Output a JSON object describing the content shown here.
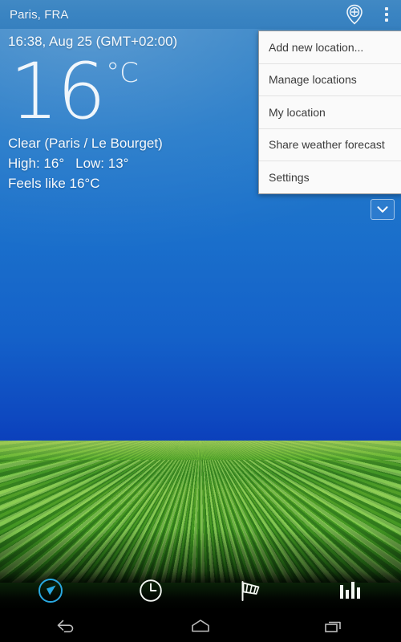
{
  "app": {
    "name": "Weather"
  },
  "actionbar": {
    "title": "Paris, FRA",
    "add_location_icon": "add-location-pin-icon",
    "overflow_icon": "overflow-menu-icon",
    "background_color": "#3a84c2"
  },
  "weather": {
    "timestamp": "16:38, Aug 25 (GMT+02:00)",
    "temperature": "16",
    "unit": "°C",
    "condition": "Clear (Paris / Le Bourget)",
    "high_label": "High: 16°",
    "low_label": "Low: 13°",
    "feels_like": "Feels like 16°C",
    "expand_icon": "chevron-down-icon"
  },
  "menu": {
    "items": [
      {
        "label": "Add new location..."
      },
      {
        "label": "Manage locations"
      },
      {
        "label": "My location"
      },
      {
        "label": "Share weather forecast"
      },
      {
        "label": "Settings"
      }
    ]
  },
  "tabbar": {
    "active_color": "#29a8e0",
    "items": [
      {
        "name": "tab-now",
        "icon": "compass-needle-icon",
        "active": true
      },
      {
        "name": "tab-hourly",
        "icon": "clock-icon",
        "active": false
      },
      {
        "name": "tab-wind",
        "icon": "windsock-icon",
        "active": false
      },
      {
        "name": "tab-chart",
        "icon": "bar-chart-icon",
        "active": false
      }
    ]
  },
  "navbar": {
    "items": [
      {
        "name": "nav-back",
        "icon": "back-arrow-icon"
      },
      {
        "name": "nav-home",
        "icon": "home-icon"
      },
      {
        "name": "nav-recents",
        "icon": "recents-icon"
      }
    ]
  }
}
